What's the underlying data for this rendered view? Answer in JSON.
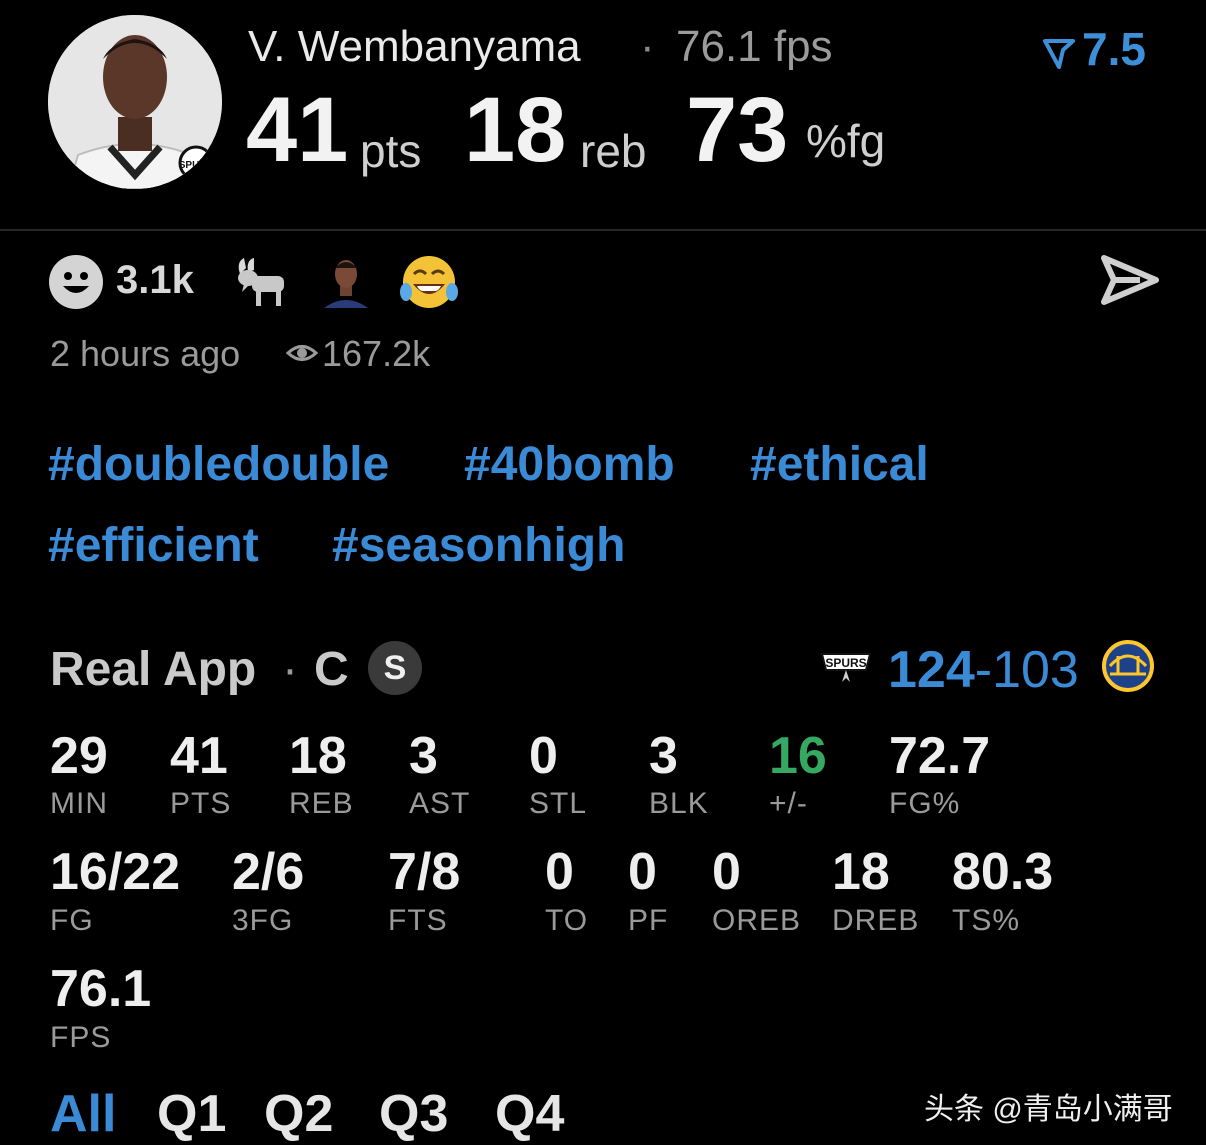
{
  "header": {
    "player_name": "V. Wembanyama",
    "separator": "·",
    "fps_text": "76.1 fps",
    "rating": "7.5",
    "headline": [
      {
        "value": "41",
        "unit": "pts"
      },
      {
        "value": "18",
        "unit": "reb"
      },
      {
        "value": "73",
        "unit": "%fg"
      }
    ]
  },
  "reactions": {
    "count": "3.1k",
    "time_ago": "2 hours ago",
    "views": "167.2k",
    "icons": [
      "smiley-icon",
      "goat-icon",
      "player-face-icon",
      "tears-of-joy-icon"
    ]
  },
  "hashtags": [
    "#doubledouble",
    "#40bomb",
    "#ethical",
    "#efficient",
    "#seasonhigh"
  ],
  "game": {
    "source": "Real App",
    "separator": "·",
    "position": "C",
    "badge": "S",
    "score_home": "124",
    "score_dash": "-",
    "score_away": "103"
  },
  "stats": {
    "row1": [
      {
        "value": "29",
        "label": "MIN"
      },
      {
        "value": "41",
        "label": "PTS"
      },
      {
        "value": "18",
        "label": "REB"
      },
      {
        "value": "3",
        "label": "AST"
      },
      {
        "value": "0",
        "label": "STL"
      },
      {
        "value": "3",
        "label": "BLK"
      },
      {
        "value": "16",
        "label": "+/-"
      },
      {
        "value": "72.7",
        "label": "FG%"
      }
    ],
    "row2": [
      {
        "value": "16/22",
        "label": "FG"
      },
      {
        "value": "2/6",
        "label": "3FG"
      },
      {
        "value": "7/8",
        "label": "FTS"
      },
      {
        "value": "0",
        "label": "TO"
      },
      {
        "value": "0",
        "label": "PF"
      },
      {
        "value": "0",
        "label": "OREB"
      },
      {
        "value": "18",
        "label": "DREB"
      },
      {
        "value": "80.3",
        "label": "TS%"
      }
    ],
    "row3": [
      {
        "value": "76.1",
        "label": "FPS"
      }
    ]
  },
  "tabs": [
    "All",
    "Q1",
    "Q2",
    "Q3",
    "Q4"
  ],
  "active_tab": "All",
  "watermark": "头条 @青岛小满哥",
  "colors": {
    "accent_blue": "#3a8ad6",
    "positive_green": "#35a862",
    "background": "#000000"
  }
}
